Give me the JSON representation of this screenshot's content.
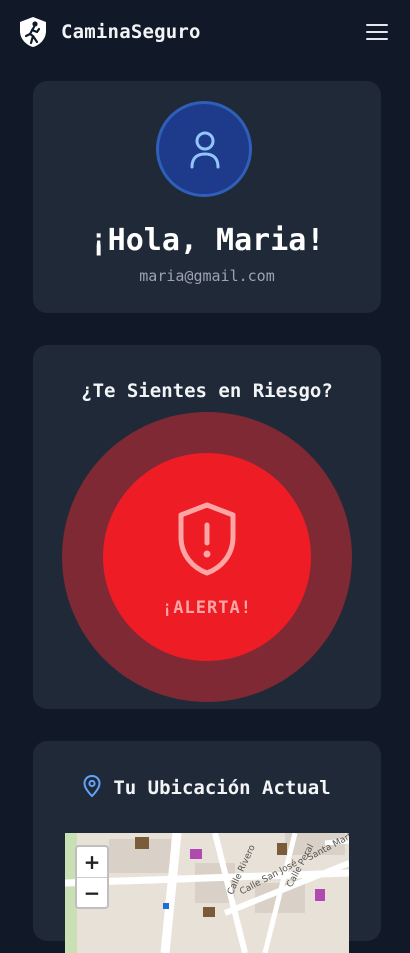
{
  "header": {
    "brand": "CaminaSeguro",
    "logo_icon": "walking-person-shield-icon",
    "menu_icon": "hamburger-menu-icon"
  },
  "profile": {
    "avatar_icon": "user-icon",
    "greeting": "¡Hola, Maria!",
    "email": "maria@gmail.com"
  },
  "alert": {
    "title": "¿Te Sientes en Riesgo?",
    "button_label": "¡ALERTA!",
    "icon": "shield-alert-icon",
    "colors": {
      "outer": "#7f2935",
      "inner": "#ee1c25",
      "label": "#fca5a5"
    }
  },
  "location": {
    "title": "Tu Ubicación Actual",
    "icon": "map-pin-icon",
    "map": {
      "zoom_in": "+",
      "zoom_out": "−",
      "streets": [
        "Santa Marta",
        "Calle Rivero",
        "Calle San José",
        "Calle Peral"
      ]
    }
  }
}
